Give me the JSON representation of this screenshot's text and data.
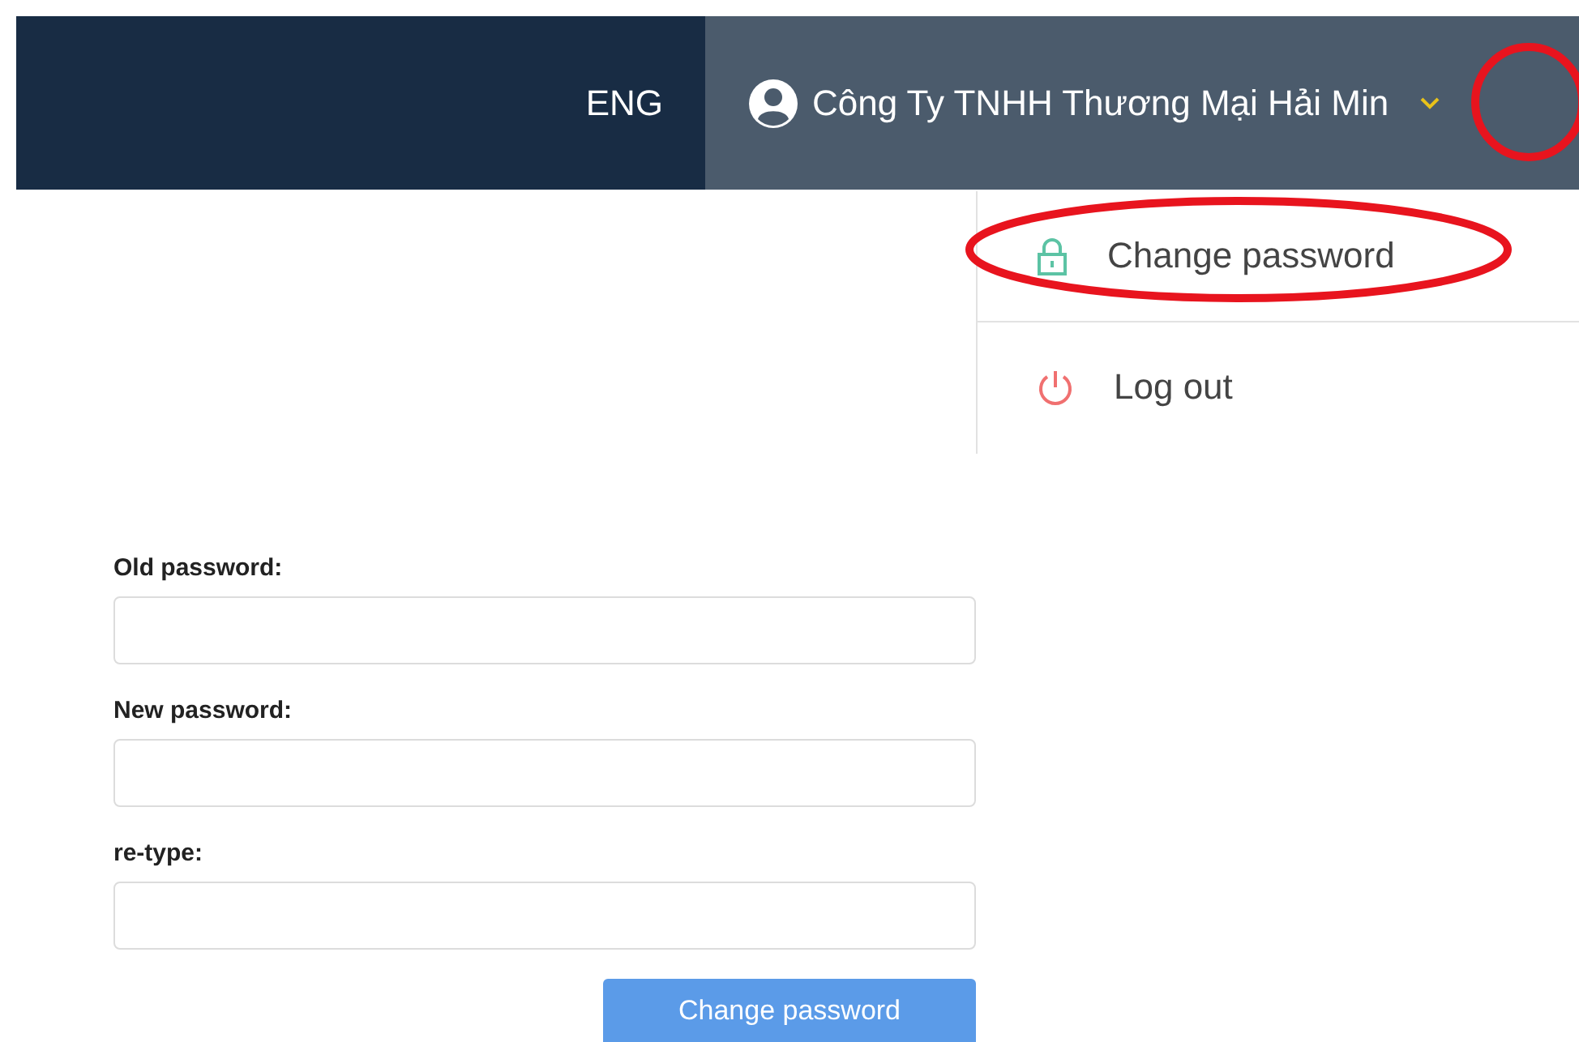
{
  "header": {
    "language": "ENG",
    "user_name": "Công Ty TNHH Thương Mại Hải Min",
    "menu_open": true
  },
  "user_menu": [
    {
      "kind": "lock",
      "label": "Change password"
    },
    {
      "kind": "power",
      "label": "Log out"
    }
  ],
  "form": {
    "fields": [
      {
        "label": "Old password:"
      },
      {
        "label": "New password:"
      },
      {
        "label": "re-type:"
      }
    ],
    "submit": "Change password"
  }
}
